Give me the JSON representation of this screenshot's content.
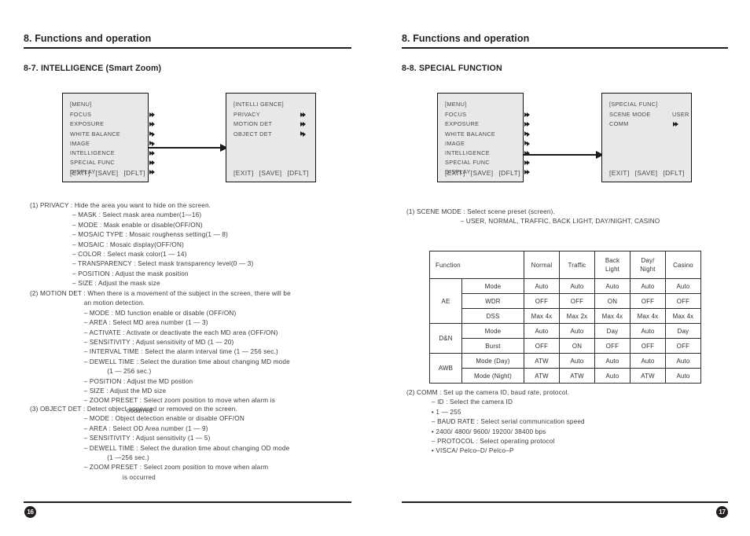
{
  "document": {
    "left_page": {
      "chapter_title": "8. Functions and operation",
      "section_title": "8-7. INTELLIGENCE (Smart Zoom)",
      "page_number": "16",
      "menu_box": {
        "title": "[MENU]",
        "items": [
          {
            "label": "FOCUS",
            "value": "arrow"
          },
          {
            "label": "EXPOSURE",
            "value": "arrow"
          },
          {
            "label": "WHITE BALANCE",
            "value": "arrow"
          },
          {
            "label": "IMAGE",
            "value": "arrow"
          },
          {
            "label": "INTELLIGENCE",
            "value": "arrow"
          },
          {
            "label": "SPECIAL FUNC",
            "value": "arrow"
          },
          {
            "label": "DISPLAY",
            "value": "arrow"
          }
        ],
        "footer": [
          "[EXIT]",
          "[SAVE]",
          "[DFLT]"
        ]
      },
      "sub_box": {
        "title": "[INTELLI GENCE]",
        "items": [
          {
            "label": "PRIVACY",
            "value": "arrow"
          },
          {
            "label": "MOTION DET",
            "value": "arrow"
          },
          {
            "label": "OBJECT DET",
            "value": "arrow"
          }
        ],
        "footer": [
          "[EXIT]",
          "[SAVE]",
          "[DFLT]"
        ]
      },
      "body_text": "(1) PRIVACY : Hide the area you want to hide on the screen.\n                      – MASK : Select mask area number(1—16)\n                      – MODE : Mask enable or disable(OFF/ON)\n                      – MOSAIC TYPE : Mosaic roughenss setting(1 — 8)\n                      – MOSAIC : Mosaic display(OFF/ON)\n                      – COLOR : Select mask color(1 — 14)\n                      – TRANSPARENCY : Select mask transparency level(0 — 3)\n                      – POSITION : Adjust the mask position\n                      – SIZE : Adjust the mask size",
      "body_text_2": "(2) MOTION DET : When there is a movement of the subject in the screen, there will be\n                            an motion detection.\n                            – MODE : MD function enable or disable (OFF/ON)\n                            – AREA : Select MD area number (1 — 3)\n                            – ACTIVATE : Activate or deactivate the each MD area (OFF/ON)\n                            – SENSITIVITY : Adjust sensitivity of MD (1 — 20)\n                            – INTERVAL TIME : Select the alarm interval time (1 — 256 sec.)\n                            – DEWELL TIME : Select the duration time about changing MD mode\n                                        (1 — 256 sec.)\n                            – POSITION : Adjust the MD postion\n                            – SIZE : Adjust the MD size\n                            – ZOOM PRESET : Select zoom position to move when alarm is\n                                                  occurred",
      "body_text_3": "(3) OBJECT DET : Detect object appeared or removed on the screen.\n                            – MODE : Object detection enable or disable OFF/ON\n                            – AREA : Select OD Area number (1 — 9)\n                            – SENSITIVITY : Adjust sensitivity (1 — 5)\n                            – DEWELL TIME : Select the duration time about changing OD mode\n                                        (1 —256 sec.)\n                            – ZOOM PRESET : Select zoom position to move when alarm\n                                                is occurred"
    },
    "right_page": {
      "chapter_title": "8. Functions and operation",
      "section_title": "8-8. SPECIAL FUNCTION",
      "page_number": "17",
      "menu_box": {
        "title": "[MENU]",
        "items": [
          {
            "label": "FOCUS",
            "value": "arrow"
          },
          {
            "label": "EXPOSURE",
            "value": "arrow"
          },
          {
            "label": "WHITE BALANCE",
            "value": "arrow"
          },
          {
            "label": "IMAGE",
            "value": "arrow"
          },
          {
            "label": "INTELLIGENCE",
            "value": "arrow"
          },
          {
            "label": "SPECIAL FUNC",
            "value": "arrow"
          },
          {
            "label": "DISPLAY",
            "value": "arrow"
          }
        ],
        "footer": [
          "[EXIT]",
          "[SAVE]",
          "[DFLT]"
        ]
      },
      "sub_box": {
        "title": "[SPECIAL FUNC]",
        "items": [
          {
            "label": "SCENE MODE",
            "value": "USER"
          },
          {
            "label": "COMM",
            "value": "arrow"
          }
        ],
        "footer": [
          "[EXIT]",
          "[SAVE]",
          "[DFLT]"
        ]
      },
      "body_text": "(1) SCENE MODE : Select scene preset (screen).\n                            – USER, NORMAL, TRAFFIC, BACK LIGHT, DAY/NIGHT, CASINO",
      "body_text_2": "(2) COMM : Set up the camera ID, baud rate, protocol.\n             – ID : Select the camera ID\n             • 1 — 255\n             – BAUD RATE : Select serial communication speed\n             • 2400/ 4800/ 9600/ 19200/ 38400 bps\n             – PROTOCOL : Select operating protocol\n             • VISCA/ Pelco–D/ Pelco–P",
      "table": {
        "header": [
          "Function",
          "Normal",
          "Traffic",
          "Back\nLight",
          "Day/\nNight",
          "Casino"
        ],
        "groups": [
          {
            "name": "AE",
            "rows": [
              {
                "sub": "Mode",
                "values": [
                  "Auto",
                  "Auto",
                  "Auto",
                  "Auto",
                  "Auto"
                ]
              },
              {
                "sub": "WDR",
                "values": [
                  "OFF",
                  "OFF",
                  "ON",
                  "OFF",
                  "OFF"
                ]
              },
              {
                "sub": "DSS",
                "values": [
                  "Max 4x",
                  "Max 2x",
                  "Max 4x",
                  "Max 4x",
                  "Max 4x"
                ]
              }
            ]
          },
          {
            "name": "D&N",
            "rows": [
              {
                "sub": "Mode",
                "values": [
                  "Auto",
                  "Auto",
                  "Day",
                  "Auto",
                  "Day"
                ]
              },
              {
                "sub": "Burst",
                "values": [
                  "OFF",
                  "ON",
                  "OFF",
                  "OFF",
                  "OFF"
                ]
              }
            ]
          },
          {
            "name": "AWB",
            "rows": [
              {
                "sub": "Mode (Day)",
                "values": [
                  "ATW",
                  "Auto",
                  "Auto",
                  "Auto",
                  "Auto"
                ]
              },
              {
                "sub": "Mode (Night)",
                "values": [
                  "ATW",
                  "ATW",
                  "Auto",
                  "ATW",
                  "Auto"
                ]
              }
            ]
          }
        ]
      }
    }
  }
}
